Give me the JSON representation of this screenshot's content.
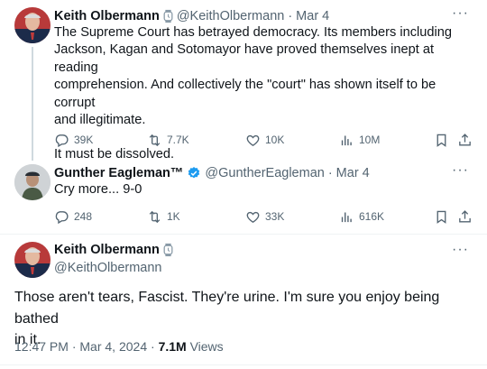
{
  "tweets": [
    {
      "name": "Keith Olbermann",
      "handle": "@KeithOlbermann",
      "date": "Mar 4",
      "text_lines": [
        "The Supreme Court has betrayed democracy. Its members including",
        "Jackson, Kagan and Sotomayor have proved themselves inept at reading",
        "comprehension. And collectively the \"court\" has shown itself to be corrupt",
        "and illegitimate."
      ],
      "text_extra": "It must be dissolved.",
      "replies": "39K",
      "reposts": "7.7K",
      "likes": "10K",
      "views": "10M"
    },
    {
      "name": "Gunther Eagleman™",
      "handle": "@GuntherEagleman",
      "date": "Mar 4",
      "text_lines": [
        "Cry more... 9-0"
      ],
      "replies": "248",
      "reposts": "1K",
      "likes": "33K",
      "views": "616K"
    }
  ],
  "main_tweet": {
    "name": "Keith Olbermann",
    "handle": "@KeithOlbermann",
    "text_lines": [
      "Those aren't tears, Fascist. They're urine. I'm sure you enjoy being bathed",
      "in it."
    ],
    "time": "12:47 PM",
    "date": "Mar 4, 2024",
    "views_count": "7.1M",
    "views_label": "Views"
  },
  "separator": "·",
  "more_glyph": "···",
  "colors": {
    "text": "#0f1419",
    "secondary": "#536471",
    "verified": "#1d9bf0",
    "divider": "#eff3f4"
  },
  "icons": [
    "reply-icon",
    "repost-icon",
    "like-icon",
    "views-icon",
    "bookmark-icon",
    "share-icon",
    "more-icon",
    "verified-badge-icon",
    "watch-badge-icon"
  ]
}
